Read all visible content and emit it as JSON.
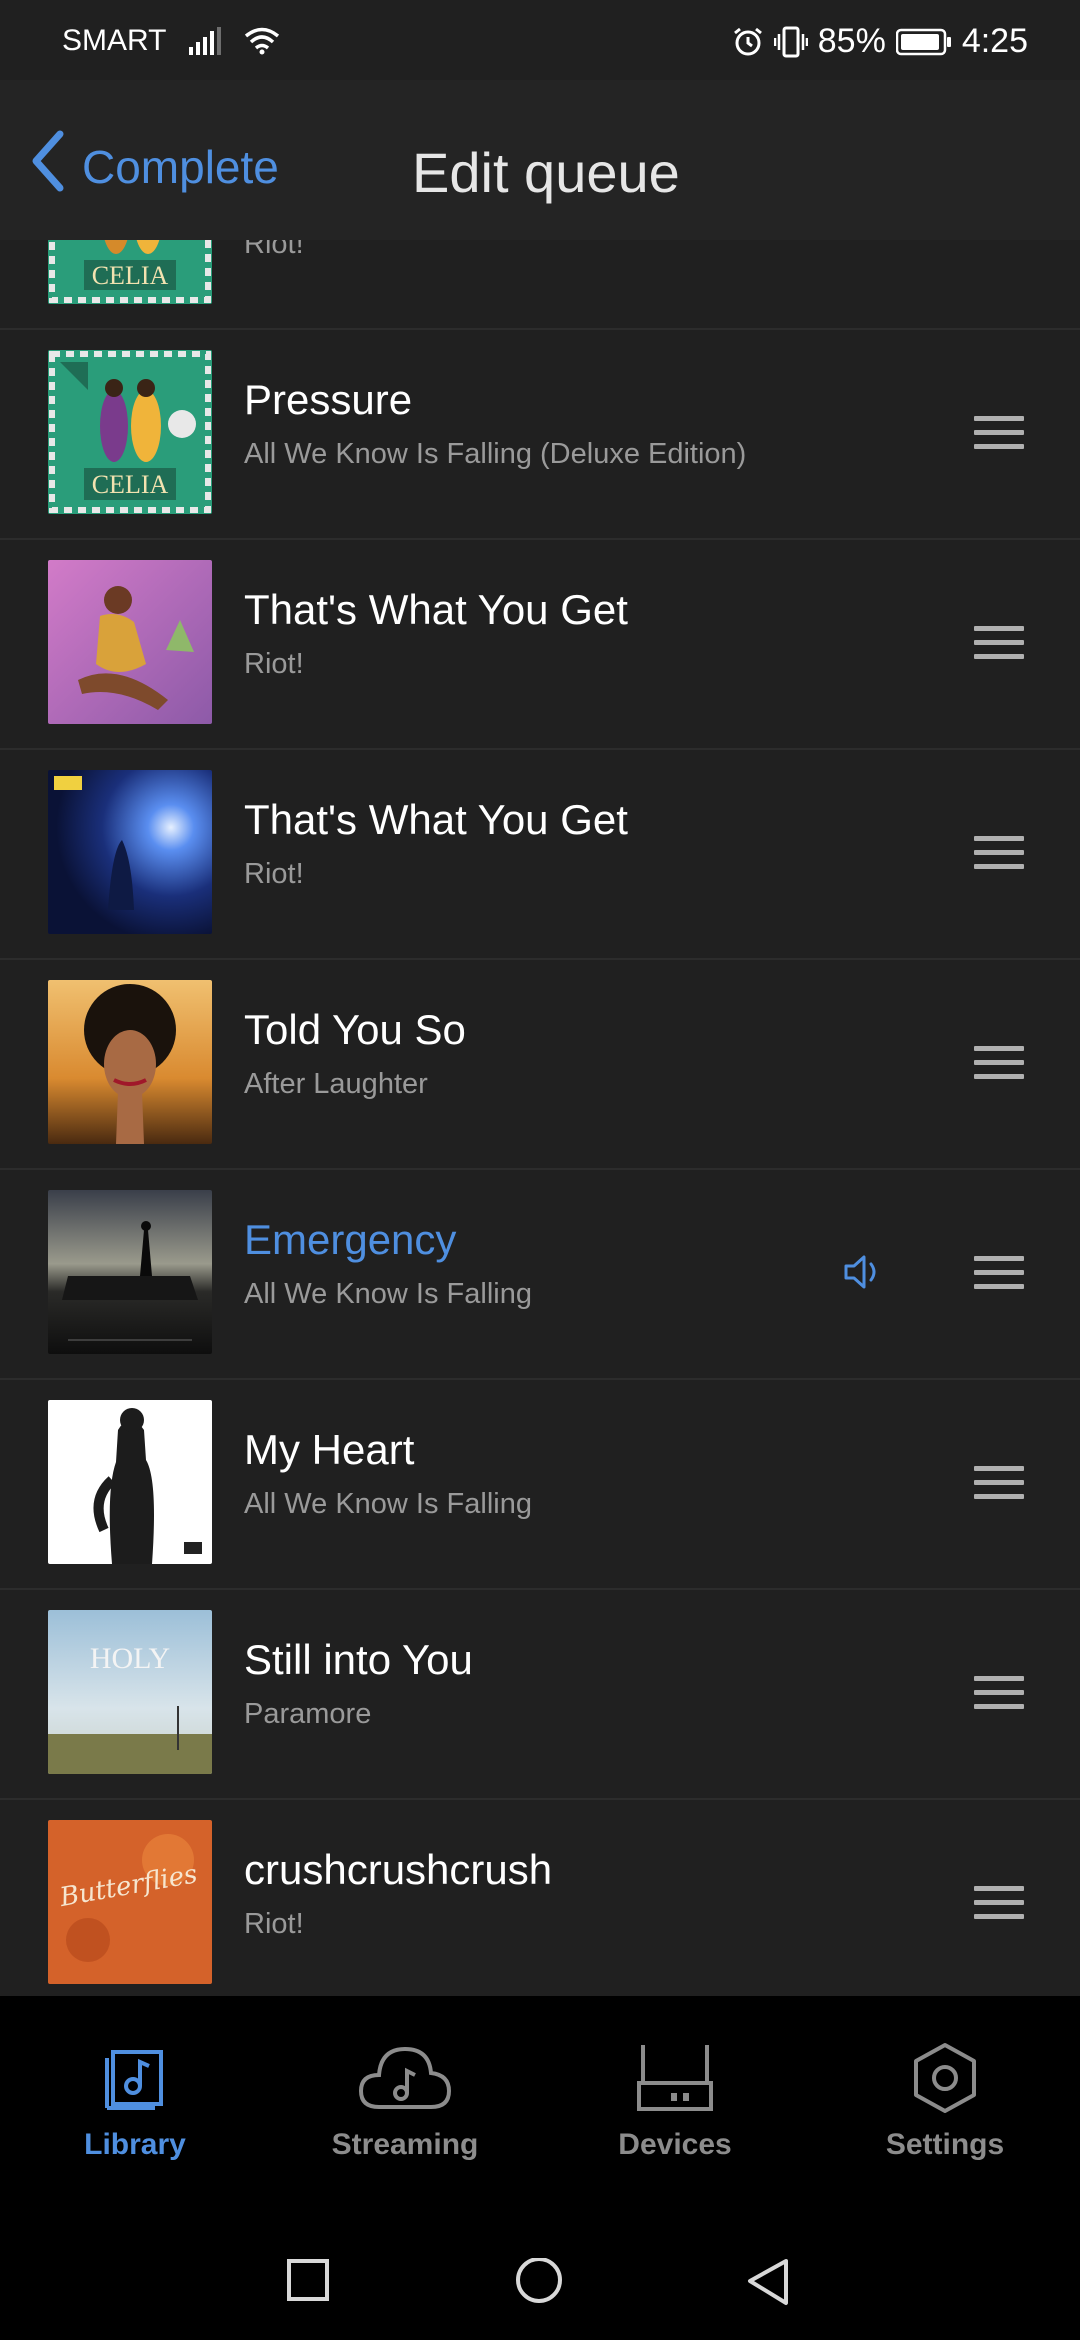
{
  "status_bar": {
    "carrier": "SMART",
    "battery": "85%",
    "time": "4:25"
  },
  "header": {
    "back_label": "Complete",
    "title": "Edit queue"
  },
  "queue": [
    {
      "title": "",
      "subtitle": "Riot!",
      "art": "celia"
    },
    {
      "title": "Pressure",
      "subtitle": "All We Know Is Falling (Deluxe Edition)",
      "art": "celia"
    },
    {
      "title": "That's What You Get",
      "subtitle": "Riot!",
      "art": "pink"
    },
    {
      "title": "That's What You Get",
      "subtitle": "Riot!",
      "art": "blue"
    },
    {
      "title": "Told You So",
      "subtitle": "After Laughter",
      "art": "portrait"
    },
    {
      "title": "Emergency",
      "subtitle": "All We Know Is Falling",
      "art": "dusk",
      "playing": true
    },
    {
      "title": "My Heart",
      "subtitle": "All We Know Is Falling",
      "art": "white"
    },
    {
      "title": "Still into You",
      "subtitle": "Paramore",
      "art": "holy",
      "art_text": "HOLY"
    },
    {
      "title": "crushcrushcrush",
      "subtitle": "Riot!",
      "art": "orange",
      "art_text": "Butterflies"
    }
  ],
  "bottom_nav": {
    "library": "Library",
    "streaming": "Streaming",
    "devices": "Devices",
    "settings": "Settings"
  },
  "colors": {
    "accent": "#4f8fe0",
    "background": "#202020",
    "header": "#242424",
    "nav": "#000000"
  },
  "icons": {
    "signal": "signal-icon",
    "wifi": "wifi-icon",
    "alarm": "alarm-icon",
    "vibrate": "vibrate-icon",
    "battery": "battery-icon",
    "back": "chevron-left-icon",
    "drag": "drag-handle-icon",
    "speaker": "speaker-icon",
    "library": "library-icon",
    "streaming": "cloud-icon",
    "devices": "device-icon",
    "settings": "settings-icon"
  }
}
